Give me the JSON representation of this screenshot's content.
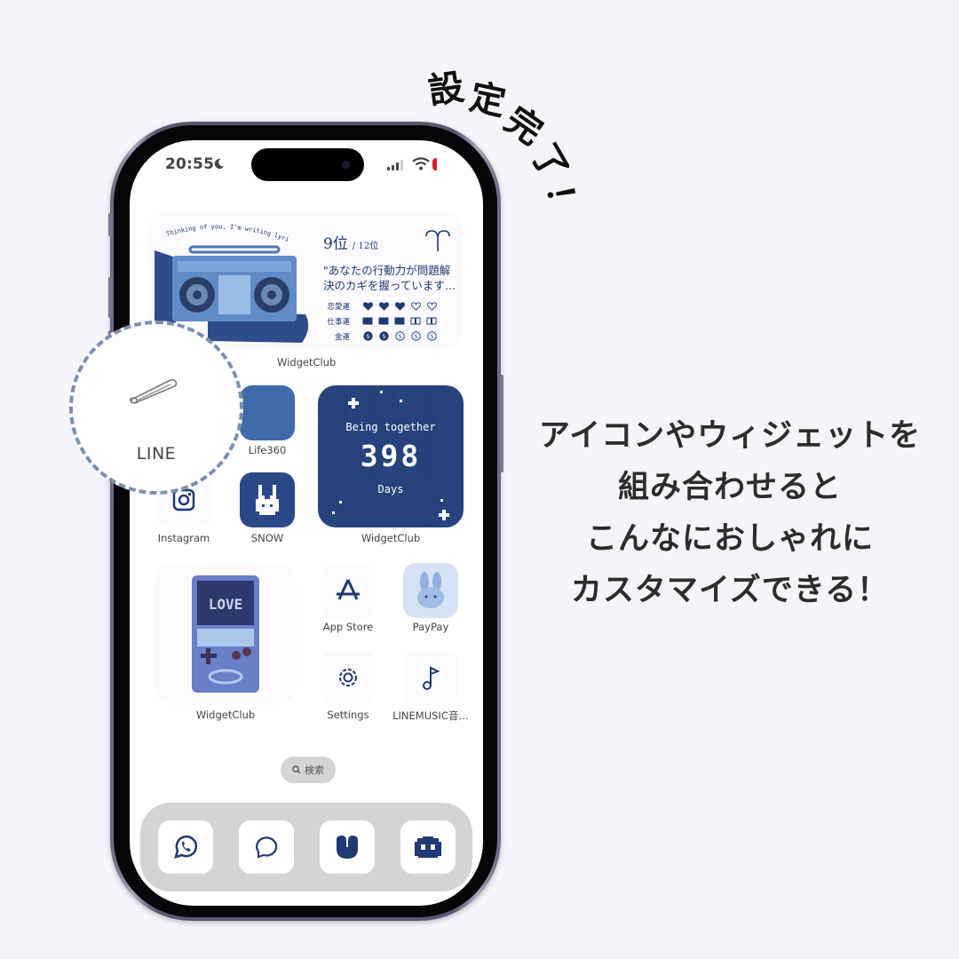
{
  "status_bar": {
    "time": "20:55",
    "focus_icon": "moon-icon",
    "signal_icon": "cellular-signal-icon",
    "wifi_icon": "wifi-icon",
    "battery_icon": "battery-low-icon",
    "battery_color": "#e0192e"
  },
  "horoscope_widget": {
    "art_caption": "Thinking of you, I'm writing lyrics now.",
    "rank": "9位",
    "rank_total": "/ 12位",
    "sign_icon": "aries-icon",
    "quote_line1": "\"あなたの行動力が問題解",
    "quote_line2": "決のカギを握っています…",
    "rows": [
      {
        "label": "恋愛運",
        "icon": "heart-icon",
        "filled": 3,
        "total": 5
      },
      {
        "label": "仕事運",
        "icon": "book-icon",
        "filled": 3,
        "total": 5
      },
      {
        "label": "金運",
        "icon": "coin-icon",
        "filled": 2,
        "total": 5
      }
    ],
    "label": "WidgetClub"
  },
  "magnifier": {
    "label": "LINE",
    "icon": "safety-pin-icon"
  },
  "apps": {
    "life360": {
      "label": "Life360"
    },
    "instagram": {
      "label": "Instagram"
    },
    "snow": {
      "label": "SNOW"
    },
    "app_store": {
      "label": "App Store"
    },
    "paypay": {
      "label": "PayPay"
    },
    "settings": {
      "label": "Settings"
    },
    "linemusic": {
      "label": "LINEMUSIC音…"
    }
  },
  "days_widget": {
    "title": "Being together",
    "count": "398",
    "unit": "Days",
    "label": "WidgetClub"
  },
  "game_widget": {
    "screen_text": "LOVE",
    "label": "WidgetClub"
  },
  "search": {
    "label": "検索"
  },
  "dock": [
    "whatsapp-icon",
    "chat-bubble-icon",
    "heart-app-icon",
    "discord-icon"
  ],
  "headline": {
    "done_chars": [
      "設",
      "定",
      "完",
      "了",
      "！"
    ]
  },
  "caption": {
    "lines": [
      "アイコンやウィジェットを",
      "組み合わせると",
      "こんなにおしゃれに",
      "カスタマイズできる！"
    ]
  },
  "colors": {
    "accent_navy": "#213f7a",
    "background": "#f5f4f8"
  }
}
